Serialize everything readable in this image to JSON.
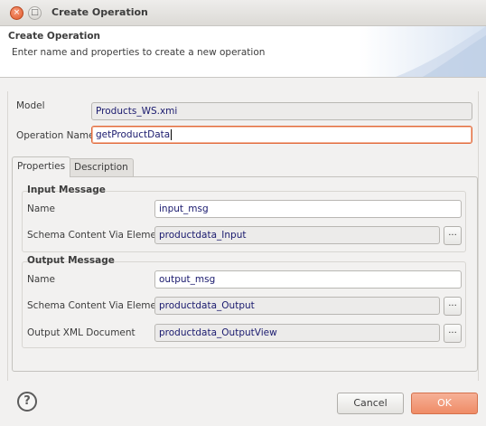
{
  "window": {
    "title": "Create Operation"
  },
  "header": {
    "title": "Create Operation",
    "subtitle": "Enter name and properties to create a new operation"
  },
  "form": {
    "model_label": "Model",
    "model_value": "Products_WS.xmi",
    "operation_name_label": "Operation Name",
    "operation_name_value": "getProductData"
  },
  "tabs": [
    {
      "label": "Properties",
      "active": true
    },
    {
      "label": "Description",
      "active": false
    }
  ],
  "input_message": {
    "title": "Input Message",
    "name_label": "Name",
    "name_value": "input_msg",
    "schema_label": "Schema Content Via Element",
    "schema_value": "productdata_Input",
    "browse_label": "..."
  },
  "output_message": {
    "title": "Output Message",
    "name_label": "Name",
    "name_value": "output_msg",
    "schema_label": "Schema Content Via Element",
    "schema_value": "productdata_Output",
    "schema_browse_label": "...",
    "xml_doc_label": "Output XML Document",
    "xml_doc_value": "productdata_OutputView",
    "xml_doc_browse_label": "..."
  },
  "footer": {
    "help_glyph": "?",
    "cancel_label": "Cancel",
    "ok_label": "OK"
  },
  "window_controls": {
    "close_glyph": "×",
    "minimize_glyph": "□"
  },
  "colors": {
    "accent": "#e2693a",
    "ok_button": "#ef8b66",
    "field_text": "#1a1a6e"
  }
}
